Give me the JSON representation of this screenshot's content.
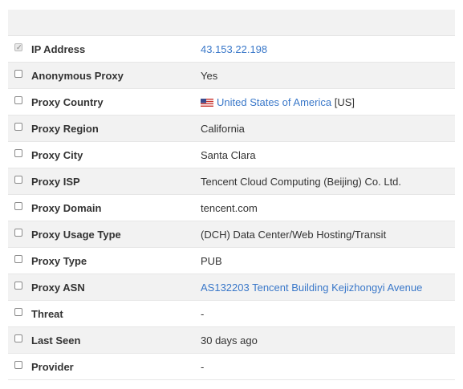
{
  "rows": [
    {
      "label": "IP Address",
      "value": "43.153.22.198",
      "checked": true
    },
    {
      "label": "Anonymous Proxy",
      "value": "Yes"
    },
    {
      "label": "Proxy Country",
      "value": "United States of America",
      "suffix": "[US]",
      "flag": "us-flag-icon"
    },
    {
      "label": "Proxy Region",
      "value": "California"
    },
    {
      "label": "Proxy City",
      "value": "Santa Clara"
    },
    {
      "label": "Proxy ISP",
      "value": "Tencent Cloud Computing (Beijing) Co. Ltd."
    },
    {
      "label": "Proxy Domain",
      "value": "tencent.com"
    },
    {
      "label": "Proxy Usage Type",
      "value": "(DCH) Data Center/Web Hosting/Transit"
    },
    {
      "label": "Proxy Type",
      "value": "PUB"
    },
    {
      "label": "Proxy ASN",
      "value": "AS132203 Tencent Building Kejizhongyi Avenue"
    },
    {
      "label": "Threat",
      "value": "-"
    },
    {
      "label": "Last Seen",
      "value": "30 days ago"
    },
    {
      "label": "Provider",
      "value": "-"
    }
  ],
  "colors": {
    "link": "#3a78c9",
    "text": "#333333",
    "stripe": "#f2f2f2"
  }
}
